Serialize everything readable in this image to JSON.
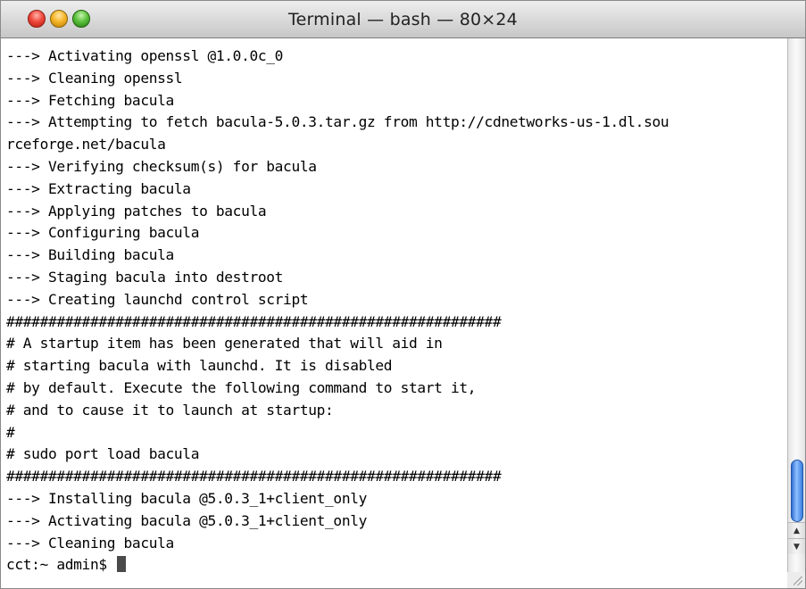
{
  "window": {
    "title": "Terminal — bash — 80×24"
  },
  "terminal": {
    "lines": [
      "---> Activating openssl @1.0.0c_0",
      "---> Cleaning openssl",
      "---> Fetching bacula",
      "---> Attempting to fetch bacula-5.0.3.tar.gz from http://cdnetworks-us-1.dl.sou",
      "rceforge.net/bacula",
      "---> Verifying checksum(s) for bacula",
      "---> Extracting bacula",
      "---> Applying patches to bacula",
      "---> Configuring bacula",
      "---> Building bacula",
      "---> Staging bacula into destroot",
      "---> Creating launchd control script",
      "###########################################################",
      "# A startup item has been generated that will aid in",
      "# starting bacula with launchd. It is disabled",
      "# by default. Execute the following command to start it,",
      "# and to cause it to launch at startup:",
      "#",
      "# sudo port load bacula",
      "###########################################################",
      "---> Installing bacula @5.0.3_1+client_only",
      "---> Activating bacula @5.0.3_1+client_only",
      "---> Cleaning bacula"
    ],
    "prompt": "cct:~ admin$ "
  },
  "icons": {
    "close": "close-icon",
    "minimize": "minimize-icon",
    "zoom": "zoom-icon",
    "scroll_up": "arrow-up-icon",
    "scroll_down": "arrow-down-icon"
  }
}
